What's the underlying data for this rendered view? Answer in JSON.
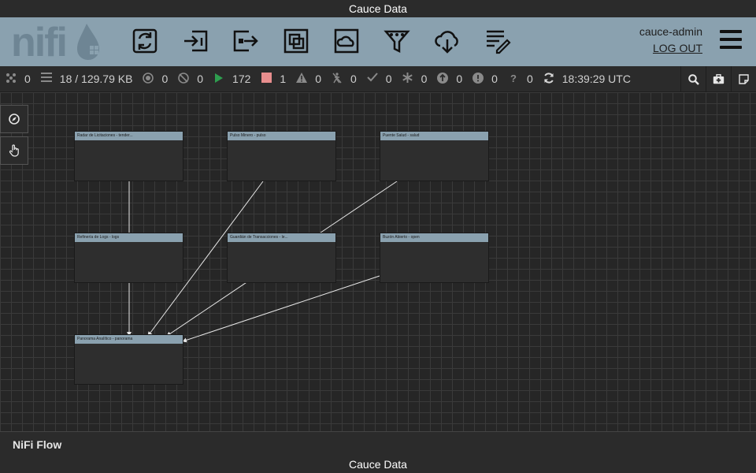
{
  "banner_top": "Cauce Data",
  "banner_bottom": "Cauce Data",
  "logo_text": "nifi",
  "toolbar": {
    "icons": [
      "processor-icon",
      "input-port-icon",
      "output-port-icon",
      "process-group-icon",
      "remote-process-group-icon",
      "funnel-icon",
      "template-icon",
      "label-icon"
    ]
  },
  "user": {
    "name": "cauce-admin",
    "logout": "LOG OUT"
  },
  "status": {
    "cluster": "0",
    "queued": "18 / 129.79 KB",
    "transmitting": "0",
    "not_transmitting": "0",
    "running": "172",
    "stopped": "1",
    "invalid": "0",
    "disabled": "0",
    "up_to_date": "0",
    "locally_modified": "0",
    "stale": "0",
    "errors": "0",
    "unknown": "0",
    "refreshed": "18:39:29 UTC"
  },
  "status_colors": {
    "running": "#2e9e4f",
    "stopped": "#e88e8e"
  },
  "process_groups": [
    {
      "id": "radar",
      "title": "Radar de Licitaciones - tender..."
    },
    {
      "id": "pulso",
      "title": "Pulso Minero - pulso"
    },
    {
      "id": "puente",
      "title": "Puente Salud - salud"
    },
    {
      "id": "refineria",
      "title": "Refinería de Logs - logs"
    },
    {
      "id": "guardian",
      "title": "Guardián de Transacciones - le..."
    },
    {
      "id": "buzon",
      "title": "Buzón Abierto - open"
    },
    {
      "id": "panorama",
      "title": "Panorama Analítico - panorama"
    }
  ],
  "breadcrumb": "NiFi Flow"
}
